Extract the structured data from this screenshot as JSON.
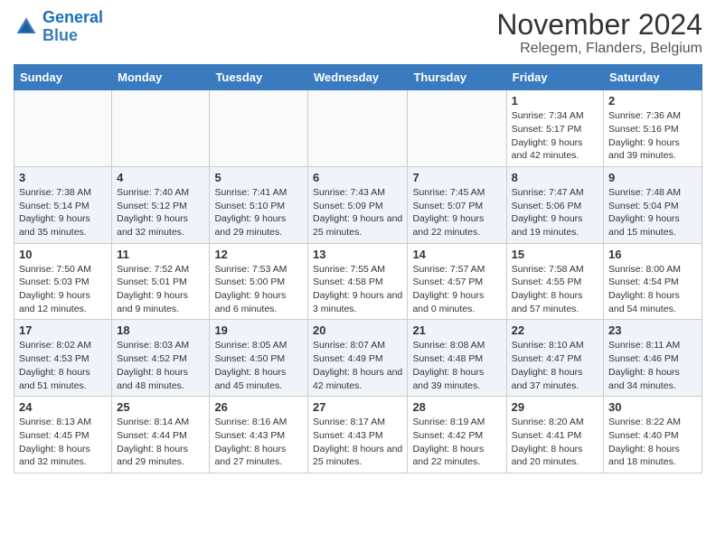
{
  "logo": {
    "line1": "General",
    "line2": "Blue"
  },
  "title": "November 2024",
  "subtitle": "Relegem, Flanders, Belgium",
  "days_of_week": [
    "Sunday",
    "Monday",
    "Tuesday",
    "Wednesday",
    "Thursday",
    "Friday",
    "Saturday"
  ],
  "weeks": [
    {
      "days": [
        {
          "num": "",
          "info": ""
        },
        {
          "num": "",
          "info": ""
        },
        {
          "num": "",
          "info": ""
        },
        {
          "num": "",
          "info": ""
        },
        {
          "num": "",
          "info": ""
        },
        {
          "num": "1",
          "info": "Sunrise: 7:34 AM\nSunset: 5:17 PM\nDaylight: 9 hours and 42 minutes."
        },
        {
          "num": "2",
          "info": "Sunrise: 7:36 AM\nSunset: 5:16 PM\nDaylight: 9 hours and 39 minutes."
        }
      ]
    },
    {
      "days": [
        {
          "num": "3",
          "info": "Sunrise: 7:38 AM\nSunset: 5:14 PM\nDaylight: 9 hours and 35 minutes."
        },
        {
          "num": "4",
          "info": "Sunrise: 7:40 AM\nSunset: 5:12 PM\nDaylight: 9 hours and 32 minutes."
        },
        {
          "num": "5",
          "info": "Sunrise: 7:41 AM\nSunset: 5:10 PM\nDaylight: 9 hours and 29 minutes."
        },
        {
          "num": "6",
          "info": "Sunrise: 7:43 AM\nSunset: 5:09 PM\nDaylight: 9 hours and 25 minutes."
        },
        {
          "num": "7",
          "info": "Sunrise: 7:45 AM\nSunset: 5:07 PM\nDaylight: 9 hours and 22 minutes."
        },
        {
          "num": "8",
          "info": "Sunrise: 7:47 AM\nSunset: 5:06 PM\nDaylight: 9 hours and 19 minutes."
        },
        {
          "num": "9",
          "info": "Sunrise: 7:48 AM\nSunset: 5:04 PM\nDaylight: 9 hours and 15 minutes."
        }
      ]
    },
    {
      "days": [
        {
          "num": "10",
          "info": "Sunrise: 7:50 AM\nSunset: 5:03 PM\nDaylight: 9 hours and 12 minutes."
        },
        {
          "num": "11",
          "info": "Sunrise: 7:52 AM\nSunset: 5:01 PM\nDaylight: 9 hours and 9 minutes."
        },
        {
          "num": "12",
          "info": "Sunrise: 7:53 AM\nSunset: 5:00 PM\nDaylight: 9 hours and 6 minutes."
        },
        {
          "num": "13",
          "info": "Sunrise: 7:55 AM\nSunset: 4:58 PM\nDaylight: 9 hours and 3 minutes."
        },
        {
          "num": "14",
          "info": "Sunrise: 7:57 AM\nSunset: 4:57 PM\nDaylight: 9 hours and 0 minutes."
        },
        {
          "num": "15",
          "info": "Sunrise: 7:58 AM\nSunset: 4:55 PM\nDaylight: 8 hours and 57 minutes."
        },
        {
          "num": "16",
          "info": "Sunrise: 8:00 AM\nSunset: 4:54 PM\nDaylight: 8 hours and 54 minutes."
        }
      ]
    },
    {
      "days": [
        {
          "num": "17",
          "info": "Sunrise: 8:02 AM\nSunset: 4:53 PM\nDaylight: 8 hours and 51 minutes."
        },
        {
          "num": "18",
          "info": "Sunrise: 8:03 AM\nSunset: 4:52 PM\nDaylight: 8 hours and 48 minutes."
        },
        {
          "num": "19",
          "info": "Sunrise: 8:05 AM\nSunset: 4:50 PM\nDaylight: 8 hours and 45 minutes."
        },
        {
          "num": "20",
          "info": "Sunrise: 8:07 AM\nSunset: 4:49 PM\nDaylight: 8 hours and 42 minutes."
        },
        {
          "num": "21",
          "info": "Sunrise: 8:08 AM\nSunset: 4:48 PM\nDaylight: 8 hours and 39 minutes."
        },
        {
          "num": "22",
          "info": "Sunrise: 8:10 AM\nSunset: 4:47 PM\nDaylight: 8 hours and 37 minutes."
        },
        {
          "num": "23",
          "info": "Sunrise: 8:11 AM\nSunset: 4:46 PM\nDaylight: 8 hours and 34 minutes."
        }
      ]
    },
    {
      "days": [
        {
          "num": "24",
          "info": "Sunrise: 8:13 AM\nSunset: 4:45 PM\nDaylight: 8 hours and 32 minutes."
        },
        {
          "num": "25",
          "info": "Sunrise: 8:14 AM\nSunset: 4:44 PM\nDaylight: 8 hours and 29 minutes."
        },
        {
          "num": "26",
          "info": "Sunrise: 8:16 AM\nSunset: 4:43 PM\nDaylight: 8 hours and 27 minutes."
        },
        {
          "num": "27",
          "info": "Sunrise: 8:17 AM\nSunset: 4:43 PM\nDaylight: 8 hours and 25 minutes."
        },
        {
          "num": "28",
          "info": "Sunrise: 8:19 AM\nSunset: 4:42 PM\nDaylight: 8 hours and 22 minutes."
        },
        {
          "num": "29",
          "info": "Sunrise: 8:20 AM\nSunset: 4:41 PM\nDaylight: 8 hours and 20 minutes."
        },
        {
          "num": "30",
          "info": "Sunrise: 8:22 AM\nSunset: 4:40 PM\nDaylight: 8 hours and 18 minutes."
        }
      ]
    }
  ]
}
